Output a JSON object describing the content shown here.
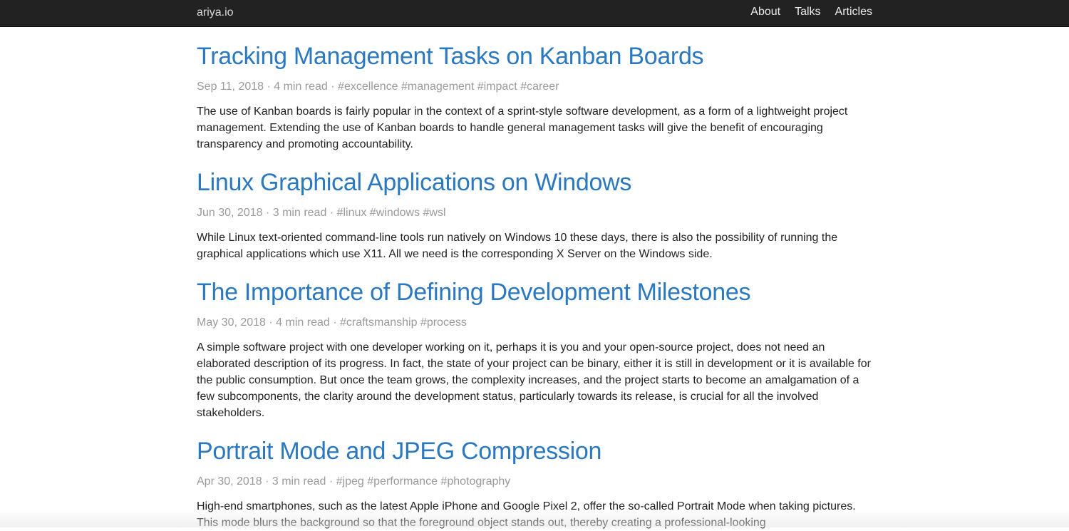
{
  "navbar": {
    "brand": "ariya.io",
    "links": [
      "About",
      "Talks",
      "Articles"
    ]
  },
  "posts": [
    {
      "title": "Tracking Management Tasks on Kanban Boards",
      "meta": "Sep 11, 2018 · 4 min read · #excellence #management #impact #career",
      "excerpt": "The use of Kanban boards is fairly popular in the context of a sprint-style software development, as a form of a lightweight project management. Extending the use of Kanban boards to handle general management tasks will give the benefit of encouraging transparency and promoting accountability."
    },
    {
      "title": "Linux Graphical Applications on Windows",
      "meta": "Jun 30, 2018 · 3 min read · #linux #windows #wsl",
      "excerpt": "While Linux text-oriented command-line tools run natively on Windows 10 these days, there is also the possibility of running the graphical applications which use X11. All we need is the corresponding X Server on the Windows side."
    },
    {
      "title": "The Importance of Defining Development Milestones",
      "meta": "May 30, 2018 · 4 min read · #craftsmanship #process",
      "excerpt": "A simple software project with one developer working on it, perhaps it is you and your open-source project, does not need an elaborated description of its progress. In fact, the state of your project can be binary, either it is still in development or it is available for the public consumption. But once the team grows, the complexity increases, and the project starts to become an amalgamation of a few subcomponents, the clarity around the development status, particularly towards its release, is crucial for all the involved stakeholders."
    },
    {
      "title": "Portrait Mode and JPEG Compression",
      "meta": "Apr 30, 2018 · 3 min read · #jpeg #performance #photography",
      "excerpt": "High-end smartphones, such as the latest Apple iPhone and Google Pixel 2, offer the so-called Portrait Mode when taking pictures. This mode blurs the background so that the foreground object stands out, thereby creating a professional-looking"
    }
  ],
  "colors": {
    "navbar_bg": "#222222",
    "title_link": "#2a78c0",
    "meta_text": "#9a9a9a",
    "body_text": "#222222"
  }
}
